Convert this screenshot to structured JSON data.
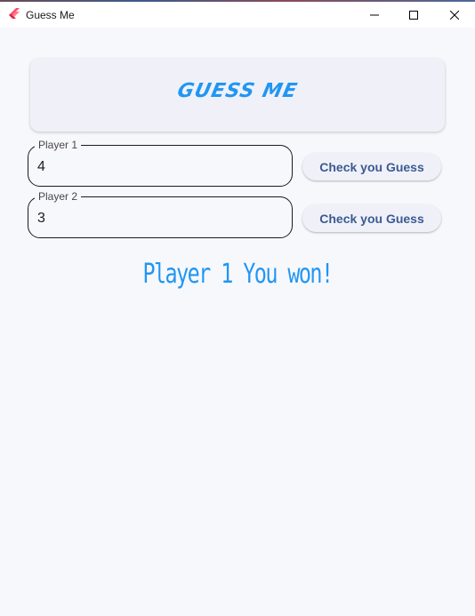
{
  "window": {
    "title": "Guess Me",
    "controls": {
      "minimize_icon": "minimize-icon",
      "maximize_icon": "maximize-icon",
      "close_icon": "close-icon"
    }
  },
  "header": {
    "title": "GUESS ME"
  },
  "players": [
    {
      "label": "Player 1",
      "value": "4",
      "button_label": "Check you Guess"
    },
    {
      "label": "Player 2",
      "value": "3",
      "button_label": "Check you Guess"
    }
  ],
  "result": {
    "message": "Player 1 You won!"
  },
  "colors": {
    "accent": "#2196f3",
    "button_text": "#3a5a92",
    "background": "#f7f8fc",
    "card": "#f0f1f8",
    "border": "#1c1b1f"
  }
}
